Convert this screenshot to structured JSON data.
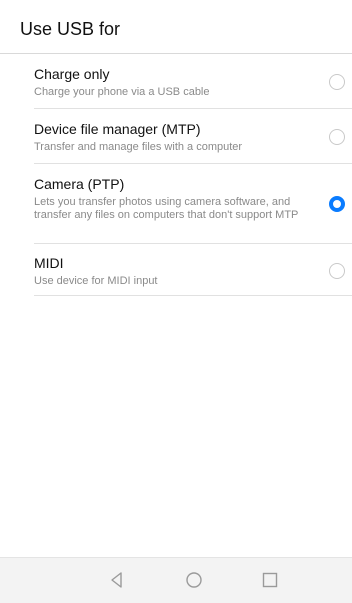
{
  "header": {
    "title": "Use USB for"
  },
  "options": [
    {
      "title": "Charge only",
      "subtitle": "Charge your phone via a USB cable",
      "selected": false
    },
    {
      "title": "Device file manager (MTP)",
      "subtitle": "Transfer and manage files with a computer",
      "selected": false
    },
    {
      "title": "Camera (PTP)",
      "subtitle": "Lets you transfer photos using camera software, and transfer any files on computers that don't support MTP",
      "selected": true
    },
    {
      "title": "MIDI",
      "subtitle": "Use device for MIDI input",
      "selected": false
    }
  ],
  "colors": {
    "accent": "#0a7cff",
    "divider": "#e1e1e1",
    "subtitle_text": "#8a8a8a",
    "nav_background": "#f3f3f3",
    "nav_icon": "#9a9a9a"
  },
  "navigation": {
    "back_icon": "triangle-back-icon",
    "home_icon": "circle-home-icon",
    "recent_icon": "square-recents-icon"
  }
}
